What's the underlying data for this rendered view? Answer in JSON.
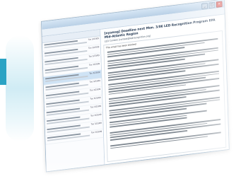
{
  "email": {
    "subject": "[nysmsg] Deadline next Mon. 3/06 LED Recognition Program EPA Mid-Atlantic Region",
    "from": "LED Contest [contest@ledrecognition.org]",
    "warning": "This email has been blocked",
    "dates": [
      "Tue 3/23/09",
      "Tue 3/23/09",
      "Tue 3/23/09",
      "Tue 3/23/09",
      "Tue 3/23/09",
      "Tue 3/23/09",
      "Tue 3/23/09",
      "Tue 3/23/09",
      "Tue 3/23/09",
      "Tue 3/23/09",
      "Tue 3/23/09",
      "Tue 3/23/09"
    ]
  },
  "colors": {
    "accent": "#2ba3c4",
    "selected_row": "#cfe3f5"
  }
}
